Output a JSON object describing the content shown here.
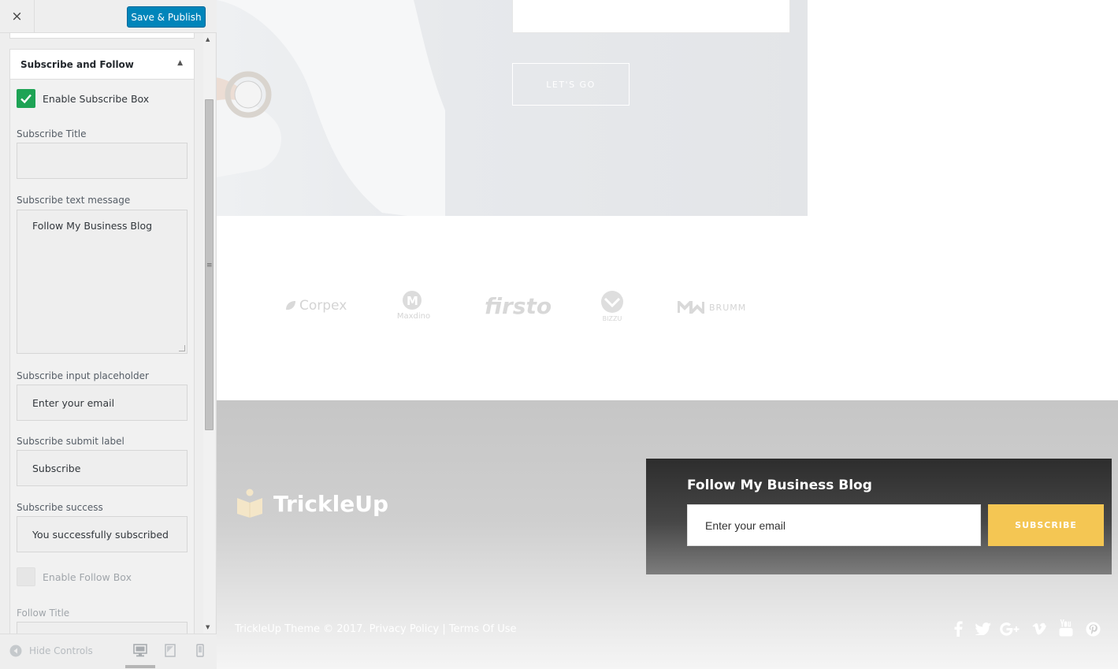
{
  "header": {
    "close_icon": "×",
    "publish_label": "Save & Publish"
  },
  "section": {
    "title": "Subscribe and Follow",
    "toggle_icon": "▲"
  },
  "fields": {
    "enable_subscribe_label": "Enable Subscribe Box",
    "enable_subscribe_checked": true,
    "subscribe_title_label": "Subscribe Title",
    "subscribe_title_value": "",
    "subscribe_text_label": "Subscribe text message",
    "subscribe_text_value": "Follow My Business Blog",
    "subscribe_placeholder_label": "Subscribe input placeholder",
    "subscribe_placeholder_value": "Enter your email",
    "subscribe_submit_label": "Subscribe submit label",
    "subscribe_submit_value": "Subscribe",
    "subscribe_success_label": "Subscribe success",
    "subscribe_success_value": "You successfully subscribed",
    "enable_follow_label": "Enable Follow Box",
    "enable_follow_checked": false,
    "follow_title_label": "Follow Title"
  },
  "footer_controls": {
    "hide_controls_label": "Hide Controls",
    "devices": [
      "desktop-icon",
      "tablet-icon",
      "mobile-icon"
    ]
  },
  "preview": {
    "hero_button_label": "LET'S GO",
    "client_logos": [
      "Corpex",
      "Maxdino",
      "firsto",
      "BIZZU",
      "BRUMM"
    ],
    "brand_name": "TrickleUp",
    "subscribe_title": "Follow My Business Blog",
    "subscribe_placeholder": "Enter your email",
    "subscribe_button": "SUBSCRIBE",
    "copyright_prefix": "TrickleUp Theme © 2017. ",
    "privacy_link": "Privacy Policy",
    "separator": " | ",
    "terms_link": "Terms Of Use",
    "social_icons": [
      "facebook-icon",
      "twitter-icon",
      "google-plus-icon",
      "vimeo-icon",
      "youtube-icon",
      "pinterest-icon"
    ]
  },
  "colors": {
    "publish_button": "#0085ba",
    "checkbox_checked": "#1ea355",
    "subscribe_button": "#f4c653",
    "subscribe_box_bg": "#2d2d2d"
  }
}
